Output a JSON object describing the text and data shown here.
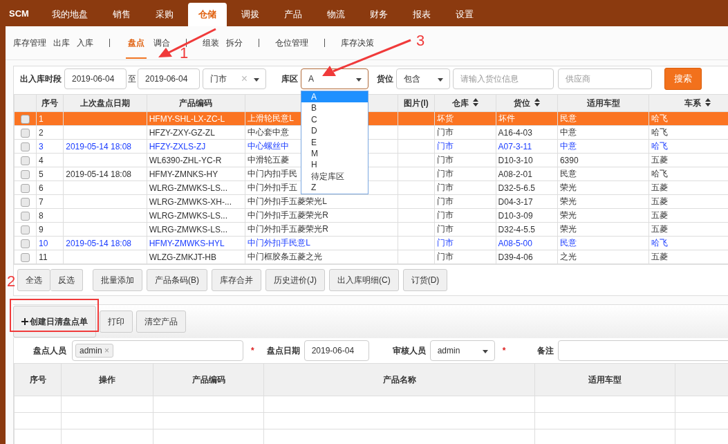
{
  "nav": {
    "logo": "SCM",
    "items": [
      {
        "label": "我的地盘",
        "selected": false
      },
      {
        "label": "销售",
        "selected": false
      },
      {
        "label": "采购",
        "selected": false
      },
      {
        "label": "仓储",
        "selected": true
      },
      {
        "label": "调拨",
        "selected": false
      },
      {
        "label": "产品",
        "selected": false
      },
      {
        "label": "物流",
        "selected": false
      },
      {
        "label": "财务",
        "selected": false
      },
      {
        "label": "报表",
        "selected": false
      },
      {
        "label": "设置",
        "selected": false
      }
    ]
  },
  "subnav": {
    "groups": [
      [
        {
          "label": "库存管理",
          "selected": false
        },
        {
          "label": "出库",
          "selected": false
        },
        {
          "label": "入库",
          "selected": false
        }
      ],
      [
        {
          "label": "盘点",
          "selected": true
        },
        {
          "label": "调合",
          "selected": false
        }
      ],
      [
        {
          "label": "组装",
          "selected": false
        },
        {
          "label": "拆分",
          "selected": false
        }
      ],
      [
        {
          "label": "仓位管理",
          "selected": false
        }
      ],
      [
        {
          "label": "库存决策",
          "selected": false
        }
      ]
    ]
  },
  "filter": {
    "period_label": "出入库时段",
    "date_from": "2019-06-04",
    "to": "至",
    "date_to": "2019-06-04",
    "store": {
      "value": "门市",
      "clear": "×"
    },
    "zone": {
      "label": "库区",
      "value": "A",
      "expanded": true,
      "options": [
        {
          "label": "A",
          "selected": true
        },
        {
          "label": "B",
          "selected": false
        },
        {
          "label": "C",
          "selected": false
        },
        {
          "label": "D",
          "selected": false
        },
        {
          "label": "E",
          "selected": false
        },
        {
          "label": "M",
          "selected": false
        },
        {
          "label": "H",
          "selected": false
        },
        {
          "label": "待定库区",
          "selected": false
        },
        {
          "label": "Z",
          "selected": false
        }
      ]
    },
    "slot": {
      "label": "货位",
      "value": "包含",
      "placeholder": "请输入货位信息"
    },
    "supplier": {
      "placeholder": "供应商"
    },
    "search_button": "搜索"
  },
  "table": {
    "columns": [
      {
        "label": "序号",
        "sortable": false
      },
      {
        "label": "上次盘点日期",
        "sortable": false
      },
      {
        "label": "产品编码",
        "sortable": false
      },
      {
        "sortable": false
      },
      {
        "label": "图片(I)",
        "sortable": false
      },
      {
        "label": "仓库",
        "sortable": true
      },
      {
        "label": "货位",
        "sortable": true
      },
      {
        "label": "适用车型",
        "sortable": false
      },
      {
        "label": "车系",
        "sortable": true
      }
    ],
    "rows": [
      {
        "checked": false,
        "selected": true,
        "flagged": false,
        "cells": [
          "1",
          "",
          "HFMY-SHL-LX-ZC-L",
          "上滑轮民意L",
          "",
          "坏货",
          "坏件",
          "民意",
          "哈飞"
        ]
      },
      {
        "checked": false,
        "selected": false,
        "flagged": false,
        "cells": [
          "2",
          "",
          "HFZY-ZXY-GZ-ZL",
          "中心套中意",
          "",
          "门市",
          "A16-4-03",
          "中意",
          "哈飞"
        ]
      },
      {
        "checked": false,
        "selected": false,
        "flagged": true,
        "cells": [
          "3",
          "2019-05-14 18:08",
          "HFZY-ZXLS-ZJ",
          "中心螺丝中",
          "",
          "门市",
          "A07-3-11",
          "中意",
          "哈飞"
        ]
      },
      {
        "checked": false,
        "selected": false,
        "flagged": false,
        "cells": [
          "4",
          "",
          "WL6390-ZHL-YC-R",
          "中滑轮五菱",
          "",
          "门市",
          "D10-3-10",
          "6390",
          "五菱"
        ]
      },
      {
        "checked": false,
        "selected": false,
        "flagged": false,
        "cells": [
          "5",
          "2019-05-14 18:08",
          "HFMY-ZMNKS-HY",
          "中门内扣手民",
          "",
          "门市",
          "A08-2-01",
          "民意",
          "哈飞"
        ]
      },
      {
        "checked": false,
        "selected": false,
        "flagged": false,
        "cells": [
          "6",
          "",
          "WLRG-ZMWKS-LS...",
          "中门外扣手五",
          "",
          "门市",
          "D32-5-6.5",
          "荣光",
          "五菱"
        ]
      },
      {
        "checked": false,
        "selected": false,
        "flagged": false,
        "cells": [
          "7",
          "",
          "WLRG-ZMWKS-XH-...",
          "中门外扣手五菱荣光L",
          "",
          "门市",
          "D04-3-17",
          "荣光",
          "五菱"
        ]
      },
      {
        "checked": false,
        "selected": false,
        "flagged": false,
        "cells": [
          "8",
          "",
          "WLRG-ZMWKS-LS...",
          "中门外扣手五菱荣光R",
          "",
          "门市",
          "D10-3-09",
          "荣光",
          "五菱"
        ]
      },
      {
        "checked": false,
        "selected": false,
        "flagged": false,
        "cells": [
          "9",
          "",
          "WLRG-ZMWKS-LS...",
          "中门外扣手五菱荣光R",
          "",
          "门市",
          "D32-4-5.5",
          "荣光",
          "五菱"
        ]
      },
      {
        "checked": false,
        "selected": false,
        "flagged": true,
        "cells": [
          "10",
          "2019-05-14 18:08",
          "HFMY-ZMWKS-HYL",
          "中门外扣手民意L",
          "",
          "门市",
          "A08-5-00",
          "民意",
          "哈飞"
        ]
      },
      {
        "checked": false,
        "selected": false,
        "flagged": false,
        "cells": [
          "11",
          "",
          "WLZG-ZMKJT-HB",
          "中门框胶条五菱之光",
          "",
          "门市",
          "D39-4-06",
          "之光",
          "五菱"
        ]
      }
    ]
  },
  "toolbar": [
    [
      "全选",
      "反选"
    ],
    [
      "批量添加"
    ],
    [
      "产品条码(B)"
    ],
    [
      "库存合并"
    ],
    [
      "历史进价(J)"
    ],
    [
      "出入库明细(C)"
    ],
    [
      "订货(D)"
    ]
  ],
  "actions": [
    {
      "label": "创建日清盘点单",
      "kind": "create"
    },
    {
      "label": "打印",
      "kind": "plain"
    },
    {
      "label": "清空产品",
      "kind": "plain"
    }
  ],
  "form": {
    "counter_label": "盘点人员",
    "counter_tags": [
      {
        "label": "admin",
        "remove": "×"
      }
    ],
    "required": "*",
    "date_label": "盘点日期",
    "date": "2019-06-04",
    "reviewer_label": "审核人员",
    "reviewer": "admin",
    "note_label": "备注"
  },
  "detail_table": {
    "columns": [
      "序号",
      "操作",
      "产品编码",
      "产品名称",
      "适用车型"
    ]
  },
  "annotations": [
    {
      "label": "1"
    },
    {
      "label": "2"
    },
    {
      "label": "3"
    }
  ]
}
